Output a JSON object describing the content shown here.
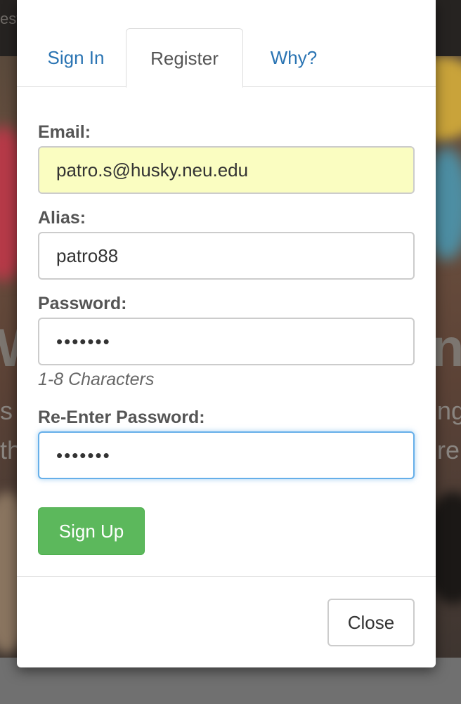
{
  "background": {
    "navbar_text": "est",
    "heading_left": "W",
    "heading_right": "n.",
    "line1_left": "s",
    "line1_right": "ng",
    "line2_left": "th",
    "line2_right": "re"
  },
  "modal": {
    "tabs": [
      {
        "label": "Sign In",
        "active": false
      },
      {
        "label": "Register",
        "active": true
      },
      {
        "label": "Why?",
        "active": false
      }
    ],
    "form": {
      "email_label": "Email:",
      "email_value": "patro.s@husky.neu.edu",
      "alias_label": "Alias:",
      "alias_value": "patro88",
      "password_label": "Password:",
      "password_value": "•••••••",
      "password_help": "1-8 Characters",
      "reenter_label": "Re-Enter Password:",
      "reenter_value": "•••••••",
      "submit_label": "Sign Up"
    },
    "close_label": "Close"
  },
  "colors": {
    "link": "#2a74b3",
    "success": "#5cb85c",
    "autofill": "#fafdc1",
    "focus": "#66afe9"
  }
}
